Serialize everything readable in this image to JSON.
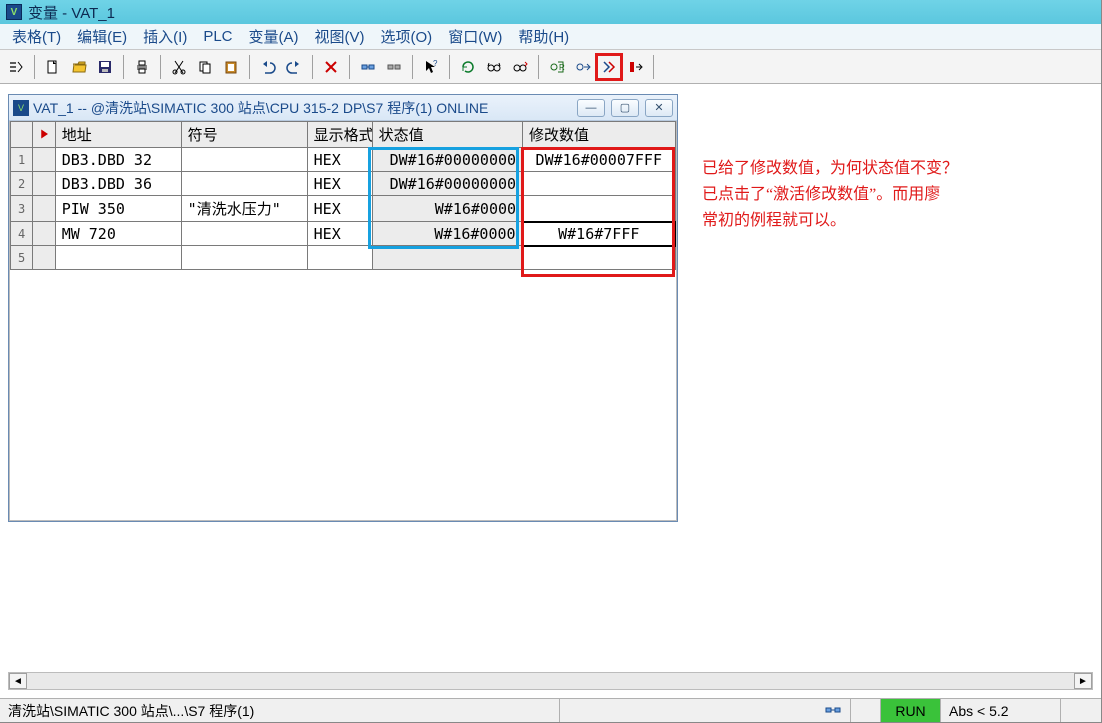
{
  "title": "变量 - VAT_1",
  "menu": {
    "table": "表格(T)",
    "edit": "编辑(E)",
    "insert": "插入(I)",
    "plc": "PLC",
    "variable": "变量(A)",
    "view": "视图(V)",
    "options": "选项(O)",
    "window": "窗口(W)",
    "help": "帮助(H)"
  },
  "child": {
    "title": "VAT_1 -- @清洗站\\SIMATIC 300 站点\\CPU 315-2 DP\\S7 程序(1)  ONLINE"
  },
  "headers": {
    "addr": "地址",
    "sym": "符号",
    "fmt": "显示格式",
    "status": "状态值",
    "mod": "修改数值"
  },
  "rows": [
    {
      "n": "1",
      "addr": "DB3.DBD   32",
      "sym": "",
      "fmt": "HEX",
      "status": "DW#16#00000000",
      "mod": "DW#16#00007FFF"
    },
    {
      "n": "2",
      "addr": "DB3.DBD   36",
      "sym": "",
      "fmt": "HEX",
      "status": "DW#16#00000000",
      "mod": ""
    },
    {
      "n": "3",
      "addr": "PIW  350",
      "sym": "\"清洗水压力\"",
      "fmt": "HEX",
      "status": "W#16#0000",
      "mod": ""
    },
    {
      "n": "4",
      "addr": "MW   720",
      "sym": "",
      "fmt": "HEX",
      "status": "W#16#0000",
      "mod": "W#16#7FFF"
    },
    {
      "n": "5",
      "addr": "",
      "sym": "",
      "fmt": "",
      "status": "",
      "mod": ""
    }
  ],
  "annotation": {
    "l1": "已给了修改数值，为何状态值不变？",
    "l2": "已点击了“激活修改数值”。而用廖",
    "l3": "常初的例程就可以。"
  },
  "status": {
    "path": "清洗站\\SIMATIC 300 站点\\...\\S7 程序(1)",
    "run": "RUN",
    "abs": "Abs < 5.2"
  }
}
